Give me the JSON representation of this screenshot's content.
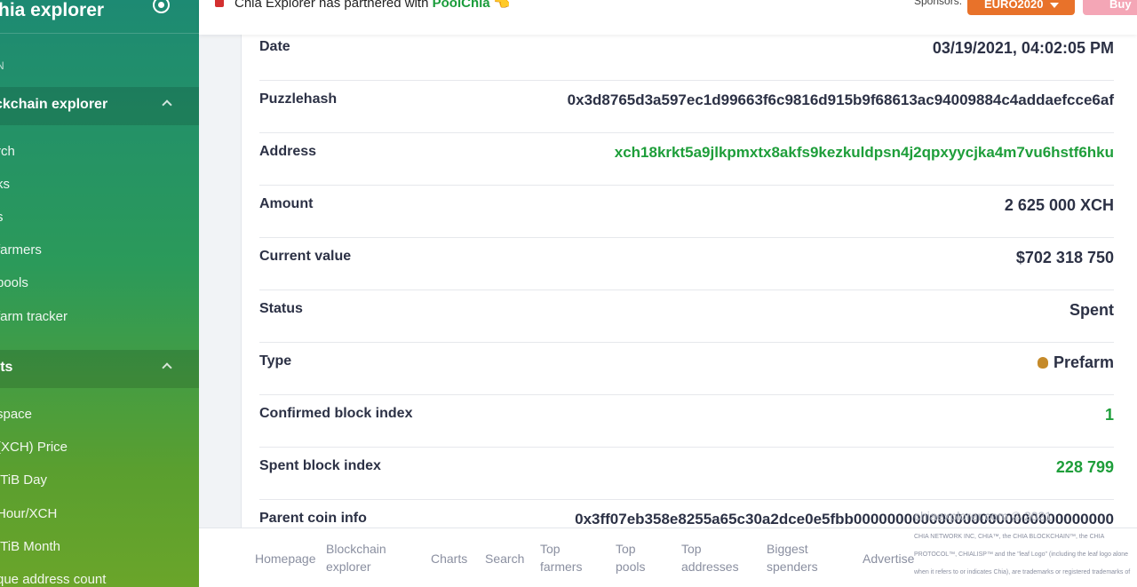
{
  "sidebar": {
    "title": "hia explorer",
    "caption": "N",
    "groups": [
      {
        "label": "ckchain explorer",
        "items": [
          "rch",
          "ks",
          "s",
          "farmers",
          "pools",
          "farm tracker"
        ]
      },
      {
        "label": "rts",
        "items": [
          "space",
          "(XCH) Price",
          "/TiB Day",
          "Hour/XCH",
          "/TiB Month",
          "que address count"
        ]
      }
    ]
  },
  "topbar": {
    "announcement_prefix": "Chia Explorer has partnered with ",
    "announcement_brand": "PoolChia",
    "announcement_emoji": "👈",
    "sponsors_label": "Sponsors:",
    "currency_button": "EURO2020",
    "buy_button": "Buy"
  },
  "details": [
    {
      "key": "Date",
      "value": "03/19/2021, 04:02:05 PM",
      "style": ""
    },
    {
      "key": "Puzzlehash",
      "value": "0x3d8765d3a597ec1d99663f6c9816d915b9f68613ac94009884c4addaefcce6af",
      "style": "small"
    },
    {
      "key": "Address",
      "value": "xch18krkt5a9jlkpmxtx8akfs9kezkuldpsn4j2qpxyycjka4m7vu6hstf6hku",
      "style": "green small"
    },
    {
      "key": "Amount",
      "value": "2 625 000 XCH",
      "style": ""
    },
    {
      "key": "Current value",
      "value": "$702 318 750",
      "style": ""
    },
    {
      "key": "Status",
      "value": "Spent",
      "style": ""
    },
    {
      "key": "Type",
      "value": "Prefarm",
      "style": ""
    },
    {
      "key": "Confirmed block index",
      "value": "1",
      "style": "green"
    },
    {
      "key": "Spent block index",
      "value": "228 799",
      "style": "green"
    },
    {
      "key": "Parent coin info",
      "value": "0x3ff07eb358e8255a65c30a2dce0e5fbb0000000000000000000000000000000",
      "style": "small"
    }
  ],
  "footer": {
    "links": [
      "Homepage",
      "Blockchain explorer",
      "Charts",
      "Search",
      "Top farmers",
      "Top pools",
      "Top addresses",
      "Biggest spenders",
      "Advertise"
    ],
    "copyright": "chiaexplorer.com © 2021",
    "legal": "CHIA NETWORK INC, CHIA™, the CHIA BLOCKCHAIN™, the CHIA PROTOCOL™, CHIALISP™ and the \"leaf Logo\" (including the leaf logo alone when it refers to or indicates Chia), are trademarks or registered trademarks of Chia Network, Inc., a Delaware corporation, used under"
  }
}
